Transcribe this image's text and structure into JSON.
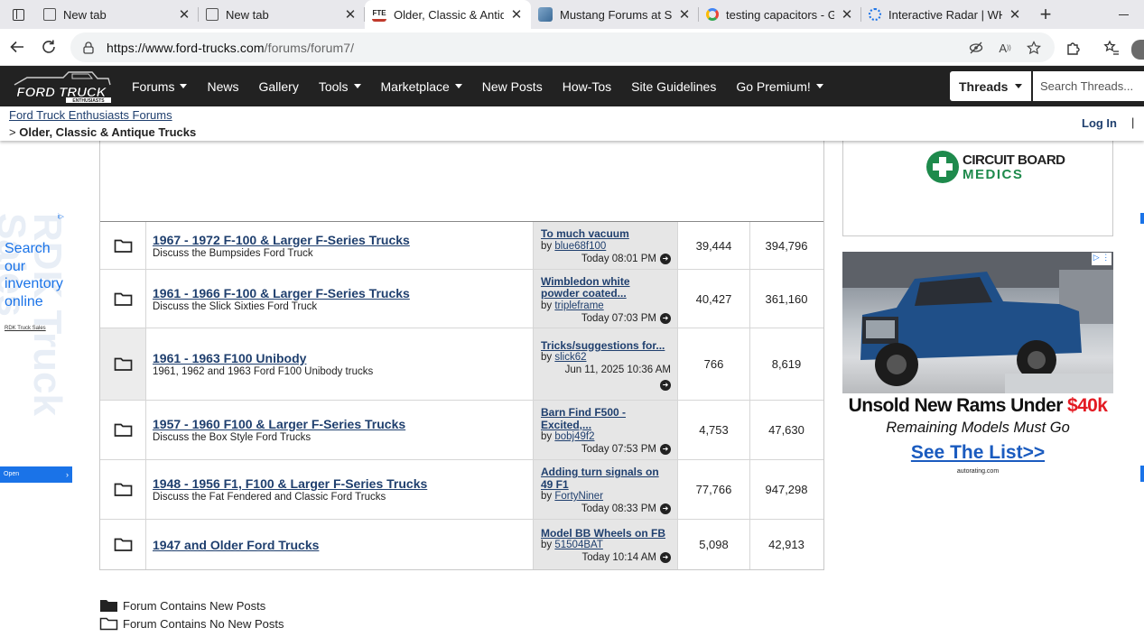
{
  "browser": {
    "tabs": [
      {
        "title": "New tab",
        "favicon": "newtab-icon",
        "active": false
      },
      {
        "title": "New tab",
        "favicon": "newtab-icon",
        "active": false
      },
      {
        "title": "Older, Classic & Antique Trucks",
        "favicon": "fte-icon",
        "active": true
      },
      {
        "title": "Mustang Forums at StangNet",
        "favicon": "stangnet-icon",
        "active": false
      },
      {
        "title": "testing capacitors - Google Search",
        "favicon": "google-icon",
        "active": false
      },
      {
        "title": "Interactive Radar | WHIO",
        "favicon": "radar-icon",
        "active": false
      }
    ],
    "favicon_labels": {
      "fte": "FTE"
    },
    "url_host": "https://www.ford-trucks.com",
    "url_path": "/forums/forum7/"
  },
  "site": {
    "logo_line1": "FORD TRUCK",
    "logo_line2": "ENTHUSIASTS",
    "nav": [
      {
        "label": "Forums",
        "dropdown": true
      },
      {
        "label": "News",
        "dropdown": false
      },
      {
        "label": "Gallery",
        "dropdown": false
      },
      {
        "label": "Tools",
        "dropdown": true
      },
      {
        "label": "Marketplace",
        "dropdown": true
      },
      {
        "label": "New Posts",
        "dropdown": false
      },
      {
        "label": "How-Tos",
        "dropdown": false
      },
      {
        "label": "Site Guidelines",
        "dropdown": false
      },
      {
        "label": "Go Premium!",
        "dropdown": true
      }
    ],
    "search_scope": "Threads",
    "search_placeholder": "Search Threads..."
  },
  "breadcrumb": {
    "home": "Ford Truck Enthusiasts Forums",
    "separator": ">",
    "current": "Older, Classic & Antique Trucks",
    "login": "Log In",
    "login_sep": "|"
  },
  "forums": [
    {
      "title": "1967 - 1972 F-100 & Larger F-Series Trucks",
      "description": "Discuss the Bumpsides Ford Truck",
      "last_post_title": "To much vacuum",
      "last_post_by_prefix": "by",
      "last_post_user": "blue68f100",
      "last_post_date": "Today 08:01 PM",
      "threads": "39,444",
      "posts": "394,796",
      "icon_gray": false
    },
    {
      "title": "1961 - 1966 F-100 & Larger F-Series Trucks",
      "description": "Discuss the Slick Sixties Ford Truck",
      "last_post_title": "Wimbledon white powder coated...",
      "last_post_by_prefix": "by",
      "last_post_user": "tripleframe",
      "last_post_date": "Today 07:03 PM",
      "threads": "40,427",
      "posts": "361,160",
      "icon_gray": false
    },
    {
      "title": "1961 - 1963 F100 Unibody",
      "description": "1961, 1962 and 1963 Ford F100 Unibody trucks",
      "last_post_title": "Tricks/suggestions for...",
      "last_post_by_prefix": "by",
      "last_post_user": "slick62",
      "last_post_date": "Jun 11, 2025 10:36 AM",
      "threads": "766",
      "posts": "8,619",
      "icon_gray": true
    },
    {
      "title": "1957 - 1960 F100 & Larger F-Series Trucks",
      "description": "Discuss the Box Style Ford Trucks",
      "last_post_title": "Barn Find F500 - Excited,...",
      "last_post_by_prefix": "by",
      "last_post_user": "bobj49f2",
      "last_post_date": "Today 07:53 PM",
      "threads": "4,753",
      "posts": "47,630",
      "icon_gray": false
    },
    {
      "title": "1948 - 1956 F1, F100 & Larger F-Series Trucks",
      "description": "Discuss the Fat Fendered and Classic Ford Trucks",
      "last_post_title": "Adding turn signals on 49 F1",
      "last_post_by_prefix": "by",
      "last_post_user": "FortyNiner",
      "last_post_date": "Today 08:33 PM",
      "threads": "77,766",
      "posts": "947,298",
      "icon_gray": false
    },
    {
      "title": "1947 and Older Ford Trucks",
      "description": "",
      "last_post_title": "Model BB Wheels on FB",
      "last_post_by_prefix": "by",
      "last_post_user": "51504BAT",
      "last_post_date": "Today 10:14 AM",
      "threads": "5,098",
      "posts": "42,913",
      "icon_gray": false
    }
  ],
  "legend": {
    "new_posts": "Forum Contains New Posts",
    "no_new_posts": "Forum Contains No New Posts"
  },
  "left_ad": {
    "headline": "Search our inventory online",
    "watermark": "RDK Truck Sales",
    "sponsor": "RDK Truck Sales",
    "open_label": "Open",
    "open_arrow": "›",
    "adchoices": "i▷"
  },
  "right_ads": {
    "cbm_line1": "CIRCUIT BOARD",
    "cbm_line2": "MEDICS",
    "ram_headline_prefix": "Unsold New Rams Under ",
    "ram_headline_price": "$40k",
    "ram_sub": "Remaining Models Must Go",
    "ram_cta": "See The List>>",
    "ram_source": "autorating.com",
    "adchoices": "▷ ⋮"
  }
}
